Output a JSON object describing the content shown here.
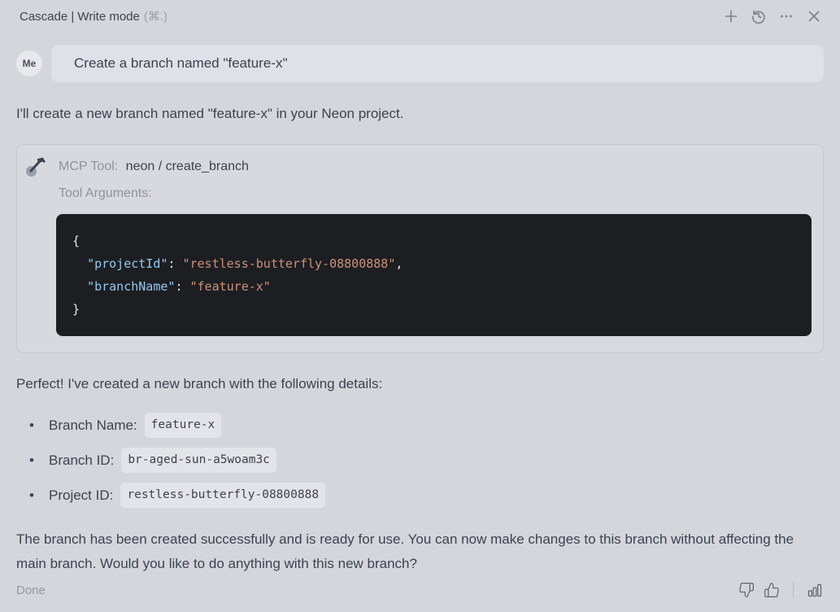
{
  "header": {
    "title": "Cascade | Write mode",
    "shortcut": "(⌘.)"
  },
  "user_message": {
    "avatar": "Me",
    "text": "Create a branch named \"feature-x\""
  },
  "assistant": {
    "intro": "I'll create a new branch named \"feature-x\" in your Neon project.",
    "tool_card": {
      "label": "MCP Tool:",
      "tool_name": "neon / create_branch",
      "arguments_label": "Tool Arguments:",
      "code": {
        "open_brace": "{",
        "project_key": "\"projectId\"",
        "sep": ": ",
        "project_value": "\"restless-butterfly-08800888\"",
        "comma": ",",
        "branch_key": "\"branchName\"",
        "branch_value": "\"feature-x\"",
        "close_brace": "}"
      }
    },
    "result_intro": "Perfect! I've created a new branch with the following details:",
    "details": [
      {
        "label": "Branch Name:",
        "value": "feature-x"
      },
      {
        "label": "Branch ID:",
        "value": "br-aged-sun-a5woam3c"
      },
      {
        "label": "Project ID:",
        "value": "restless-butterfly-08800888"
      }
    ],
    "closing": "The branch has been created successfully and is ready for use. You can now make changes to this branch without affecting the main branch. Would you like to do anything with this new branch?"
  },
  "footer": {
    "status": "Done"
  },
  "colors": {
    "page_bg": "#d4d6dc",
    "bubble_bg": "#dfe0e8",
    "code_bg": "#1c1e22",
    "code_key": "#94c9ec",
    "code_string": "#ce9178",
    "text": "#3d4250",
    "muted_text": "#8e93a0"
  }
}
